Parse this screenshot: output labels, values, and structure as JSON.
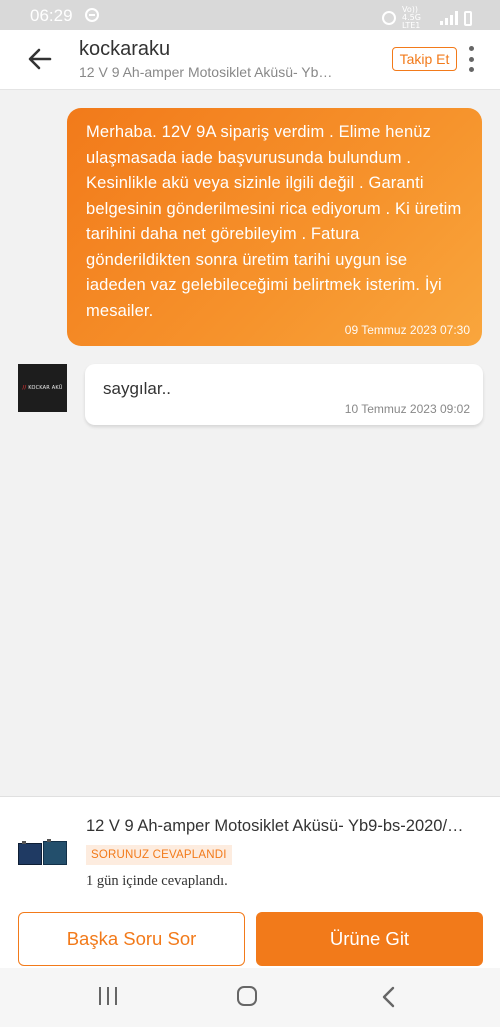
{
  "status_bar": {
    "time": "06:29",
    "network": "Vo)) 4.5G LTE1"
  },
  "header": {
    "shop_name": "kockaraku",
    "product_subtitle": "12 V 9 Ah-amper Motosiklet Aküsü- Yb9…",
    "follow_label": "Takip Et"
  },
  "messages": [
    {
      "direction": "outgoing",
      "text": "Merhaba. 12V 9A sipariş verdim . Elime henüz ulaşmasada iade başvurusunda bulundum . Kesinlikle akü veya sizinle ilgili değil . Garanti belgesinin gönderilmesini rica ediyorum . Ki üretim tarihini daha net görebileyim . Fatura gönderildikten sonra üretim tarihi uygun ise iadeden vaz gelebileceğimi belirtmek isterim. İyi mesailer.",
      "timestamp": "09 Temmuz 2023 07:30"
    },
    {
      "direction": "incoming",
      "text": "saygılar..",
      "timestamp": "10 Temmuz 2023 09:02"
    }
  ],
  "seller_avatar": {
    "logo_text": "KOCKAR AKÜ"
  },
  "product_panel": {
    "title": "12 V 9 Ah-amper Motosiklet Aküsü- Yb9-bs-2020/…",
    "status_badge": "SORUNUZ CEVAPLANDI",
    "answered_text": "1 gün içinde cevaplandı.",
    "ask_button": "Başka Soru Sor",
    "go_button": "Ürüne Git"
  },
  "colors": {
    "brand": "#f27a1a",
    "badge_bg": "#fdecdf"
  },
  "icons": [
    "back-arrow-icon",
    "more-vertical-icon",
    "recent-apps-icon",
    "home-icon",
    "nav-back-icon",
    "alarm-icon",
    "signal-icon",
    "battery-icon",
    "dnd-icon"
  ]
}
